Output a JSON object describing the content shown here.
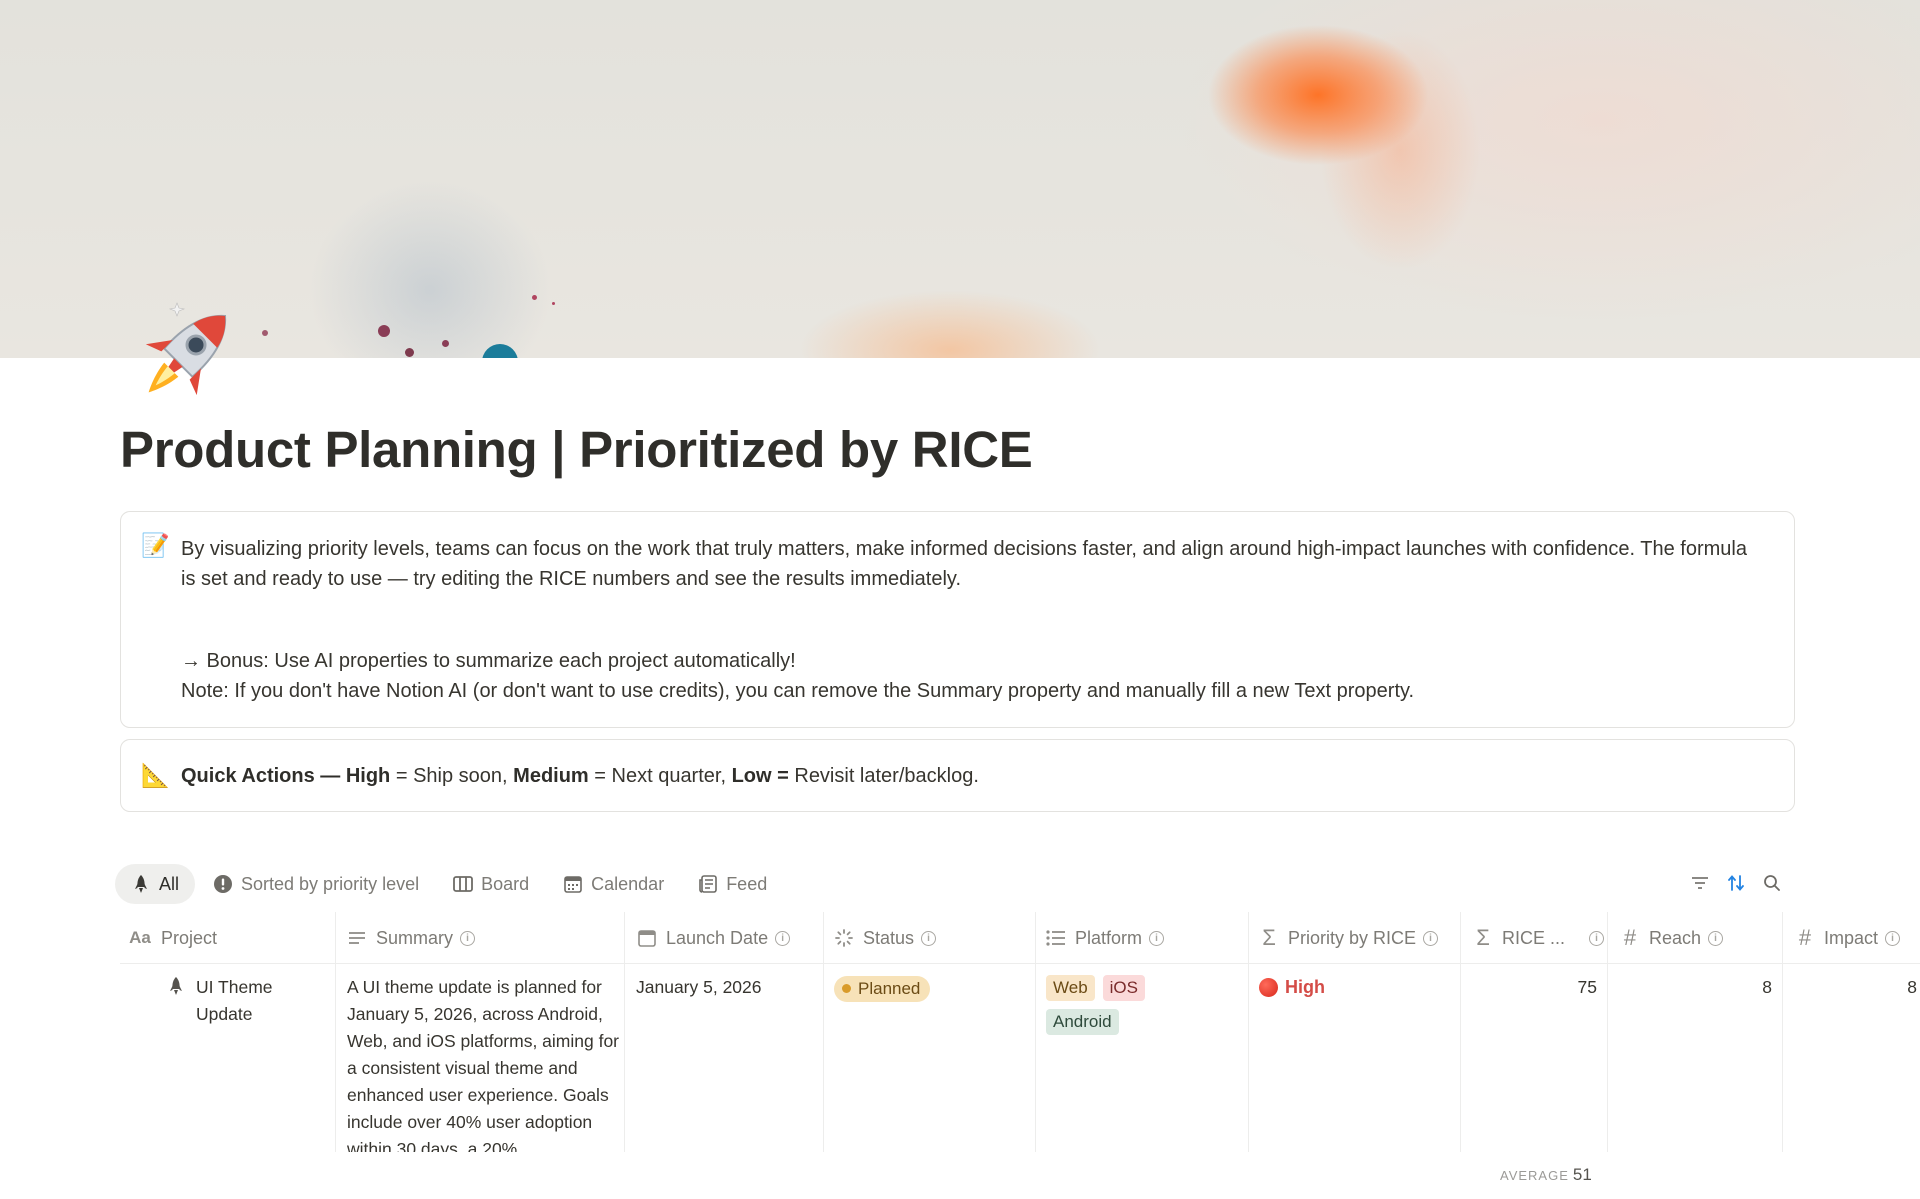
{
  "page": {
    "title": "Product Planning | Prioritized by RICE",
    "icon": "rocket-icon"
  },
  "callouts": [
    {
      "emoji": "📝",
      "paragraph1": "By visualizing priority levels, teams can focus on the work that truly matters, make informed decisions faster, and align around high-impact launches with confidence. The formula is set and ready to use — try editing the RICE numbers and see the results immediately.",
      "paragraph2_line1": "→ Bonus: Use AI properties to summarize each project automatically!",
      "paragraph2_line2": "Note: If you don't have Notion AI (or don't want to use credits), you can remove the Summary property and manually fill a new Text property."
    },
    {
      "emoji": "📐",
      "bold1": "Quick Actions — High",
      "text1": " = Ship soon, ",
      "bold2": "Medium",
      "text2": " = Next quarter, ",
      "bold3": "Low =",
      "text3": " Revisit later/backlog."
    }
  ],
  "views": [
    {
      "label": "All",
      "icon": "rocket-icon",
      "active": true
    },
    {
      "label": "Sorted by priority level",
      "icon": "alert-icon"
    },
    {
      "label": "Board",
      "icon": "board-icon"
    },
    {
      "label": "Calendar",
      "icon": "calendar-icon"
    },
    {
      "label": "Feed",
      "icon": "feed-icon"
    }
  ],
  "toolbar": {
    "filter_icon": "filter-icon",
    "sort_icon": "sort-icon",
    "search_icon": "search-icon",
    "accent": "#2383e2"
  },
  "columns": [
    {
      "label": "Project",
      "icon": "title-icon"
    },
    {
      "label": "Summary",
      "icon": "text-icon",
      "info": true
    },
    {
      "label": "Launch Date",
      "icon": "calendar-icon",
      "info": true
    },
    {
      "label": "Status",
      "icon": "status-icon",
      "info": true
    },
    {
      "label": "Platform",
      "icon": "list-icon",
      "info": true
    },
    {
      "label": "Priority by RICE",
      "icon": "formula-icon",
      "info": true
    },
    {
      "label": "RICE ...",
      "icon": "formula-icon",
      "info": true
    },
    {
      "label": "Reach",
      "icon": "number-icon",
      "info": true
    },
    {
      "label": "Impact",
      "icon": "number-icon",
      "info": true
    }
  ],
  "rows": [
    {
      "project_line1": "UI Theme",
      "project_line2": "Update",
      "summary": "A UI theme update is planned for January 5, 2026, across Android, Web, and iOS platforms, aiming for a consistent visual theme and enhanced user experience. Goals include over 40% user adoption within 30 days, a 20%",
      "launch_date": "January 5, 2026",
      "status": "Planned",
      "platforms": [
        "Web",
        "iOS",
        "Android"
      ],
      "priority": "High",
      "rice": "75",
      "reach": "8",
      "impact": "8"
    }
  ],
  "footer": {
    "average_label": "AVERAGE",
    "average_value": "51"
  }
}
